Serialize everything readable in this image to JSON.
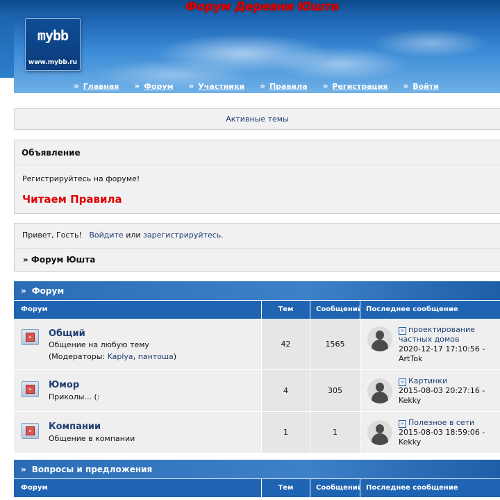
{
  "site": {
    "title": "Форум Деревни Юшта",
    "logo_mark": "mybb",
    "logo_url": "www.mybb.ru"
  },
  "nav": [
    {
      "label": "Главная"
    },
    {
      "label": "Форум"
    },
    {
      "label": "Участники"
    },
    {
      "label": "Правила"
    },
    {
      "label": "Регистрация"
    },
    {
      "label": "Войти"
    }
  ],
  "active_topics": "Активные темы",
  "announcement": {
    "heading": "Объявление",
    "text": "Регистрируйтесь на форуме!",
    "rules": "Читаем Правила"
  },
  "welcome": {
    "greeting": "Привет, Гость!",
    "login": "Войдите",
    "or": "или",
    "register": "зарегистрируйтесь.",
    "breadcrumb": "» Форум Юшта"
  },
  "columns": {
    "forum": "Форум",
    "topics": "Тем",
    "posts": "Сообщений",
    "last_post": "Последнее сообщение"
  },
  "categories": [
    {
      "title": "Форум",
      "forums": [
        {
          "name": "Общий",
          "description": "Общение на любую тему",
          "mods_prefix": "(Модераторы:",
          "mod1": "Kaplya",
          "sep": ",",
          "mod2": "пантоша",
          "mods_suffix": ")",
          "topics": "42",
          "posts": "1565",
          "last_topic_1": "проектирование",
          "last_topic_2": "частных домов",
          "last_date": "2020-12-17 17:10:56 -",
          "last_author": "ArtTok"
        },
        {
          "name": "Юмор",
          "description": "Приколы... (:",
          "topics": "4",
          "posts": "305",
          "last_topic_1": "Картинки",
          "last_date": "2015-08-03 20:27:16 -",
          "last_author": "Kekky"
        },
        {
          "name": "Компании",
          "description": "Общение в компании",
          "topics": "1",
          "posts": "1",
          "last_topic_1": "Полезное в сети",
          "last_date": "2015-08-03 18:59:06 -",
          "last_author": "Kekky"
        }
      ]
    },
    {
      "title": "Вопросы и предложения",
      "forums": []
    }
  ],
  "icons": {
    "forum": "forum-folder-icon",
    "avatar": "user-avatar-icon",
    "topic": "topic-link-icon",
    "nav_arrow": "double-chevron-icon"
  },
  "colors": {
    "title_red": "#e60000",
    "header_blue": "#1f64b3",
    "link_blue": "#1f3d73",
    "rules_red": "#e00000"
  }
}
